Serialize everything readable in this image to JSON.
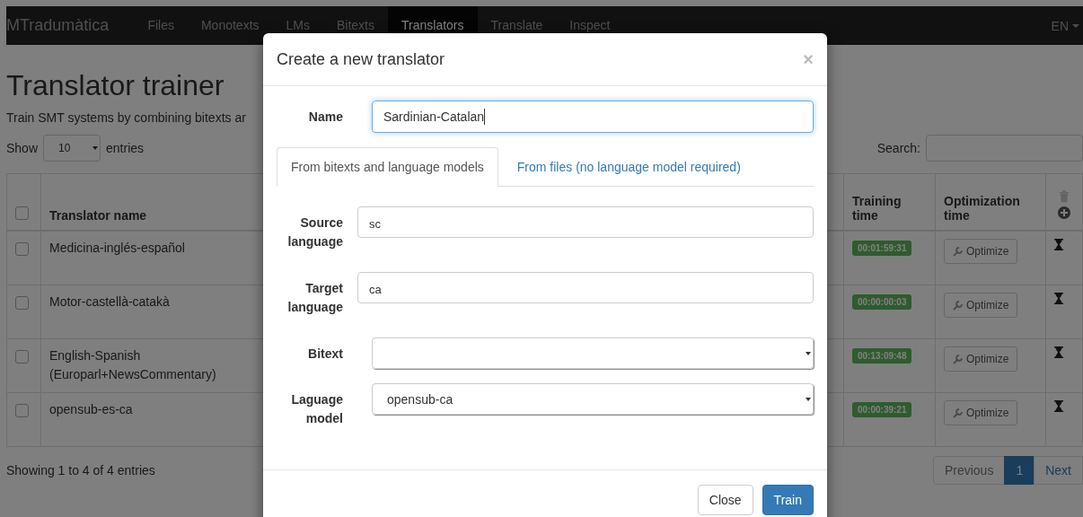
{
  "navbar": {
    "brand": "MTradumàtica",
    "items": [
      {
        "label": "Files",
        "selected": false
      },
      {
        "label": "Monotexts",
        "selected": false
      },
      {
        "label": "LMs",
        "selected": false
      },
      {
        "label": "Bitexts",
        "selected": false
      },
      {
        "label": "Translators",
        "selected": true
      },
      {
        "label": "Translate",
        "selected": false
      },
      {
        "label": "Inspect",
        "selected": false
      }
    ],
    "language": "EN"
  },
  "page": {
    "title": "Translator trainer",
    "subtitle": "Train SMT systems by combining bitexts ar",
    "show_label": "Show",
    "page_size": "10",
    "entries_label": "entries",
    "search_label": "Search:"
  },
  "table": {
    "all_checked": false,
    "columns": [
      "Translator name",
      "Training time",
      "Optimization time"
    ],
    "rows": [
      {
        "checked": false,
        "name": "Medicina-inglés-español",
        "training_time": "00:01:59:31",
        "action": "Optimize"
      },
      {
        "checked": false,
        "name": "Motor-castellà-catakà",
        "training_time": "00:00:00:03",
        "action": "Optimize"
      },
      {
        "checked": false,
        "name": "English-Spanish (Europarl+NewsCommentary)",
        "training_time": "00:13:09:48",
        "action": "Optimize"
      },
      {
        "checked": false,
        "name": "opensub-es-ca",
        "training_time": "00:00:39:21",
        "action": "Optimize"
      }
    ]
  },
  "footer": {
    "info": "Showing 1 to 4 of 4 entries",
    "pages": [
      {
        "label": "Previous",
        "selected": false
      },
      {
        "label": "1",
        "selected": true
      },
      {
        "label": "Next",
        "selected": false
      }
    ]
  },
  "modal": {
    "title": "Create a new translator",
    "close": "×",
    "name": {
      "label": "Name",
      "value": "Sardinian-Catalan"
    },
    "tabs": [
      {
        "label": "From bitexts and language models",
        "selected": true
      },
      {
        "label": "From files (no language model required)",
        "selected": false
      }
    ],
    "fields": [
      {
        "kind": "input",
        "label": "Source language",
        "value": "sc"
      },
      {
        "kind": "input",
        "label": "Target language",
        "value": "ca"
      },
      {
        "kind": "select",
        "label": "Bitext"
      },
      {
        "kind": "select",
        "label": "Laguage model",
        "value": "opensub-ca"
      }
    ],
    "buttons": [
      {
        "label": "Close",
        "kind": "default"
      },
      {
        "label": "Train",
        "kind": "primary"
      }
    ]
  }
}
